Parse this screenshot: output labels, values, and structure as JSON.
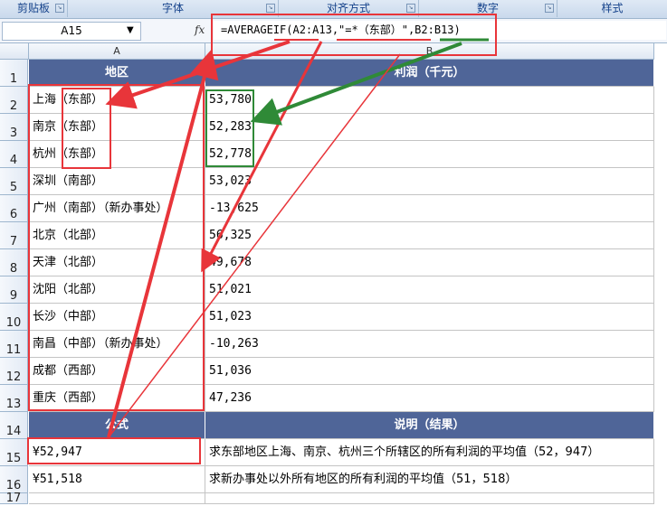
{
  "ribbon": {
    "groups": [
      {
        "label": "剪贴板"
      },
      {
        "label": "字体"
      },
      {
        "label": "对齐方式"
      },
      {
        "label": "数字"
      },
      {
        "label": "样式"
      }
    ]
  },
  "formula_bar": {
    "name_box": "A15",
    "fx_label": "fx",
    "formula": "=AVERAGEIF(A2:A13,\"=*（东部）\",B2:B13)"
  },
  "columns": [
    {
      "label": "A"
    },
    {
      "label": "B"
    }
  ],
  "rows": [
    "1",
    "2",
    "3",
    "4",
    "5",
    "6",
    "7",
    "8",
    "9",
    "10",
    "11",
    "12",
    "13",
    "14",
    "15",
    "16",
    "17"
  ],
  "table_header": {
    "region": "地区",
    "profit": "利润（千元）"
  },
  "data_rows": [
    {
      "region": "上海（东部）",
      "profit": "53,780"
    },
    {
      "region": "南京（东部）",
      "profit": "52,283"
    },
    {
      "region": "杭州（东部）",
      "profit": "52,778"
    },
    {
      "region": "深圳（南部）",
      "profit": "53,023"
    },
    {
      "region": "广州（南部）（新办事处）",
      "profit": "-13,625"
    },
    {
      "region": "北京（北部）",
      "profit": "56,325"
    },
    {
      "region": "天津（北部）",
      "profit": "49,678"
    },
    {
      "region": "沈阳（北部）",
      "profit": "51,021"
    },
    {
      "region": "长沙（中部）",
      "profit": "51,023"
    },
    {
      "region": "南昌（中部）（新办事处）",
      "profit": "-10,263"
    },
    {
      "region": "成都（西部）",
      "profit": "51,036"
    },
    {
      "region": "重庆（西部）",
      "profit": "47,236"
    }
  ],
  "formula_header": {
    "formula": "公式",
    "desc": "说明（结果）"
  },
  "formula_rows": [
    {
      "result": "¥52,947",
      "desc": "求东部地区上海、南京、杭州三个所辖区的所有利润的平均值（52，947）"
    },
    {
      "result": "¥51,518",
      "desc": "求新办事处以外所有地区的所有利润的平均值（51，518）"
    }
  ],
  "colors": {
    "header_bg": "#4f6598",
    "annotation_red": "#e8353a",
    "annotation_green": "#2f8a37"
  }
}
